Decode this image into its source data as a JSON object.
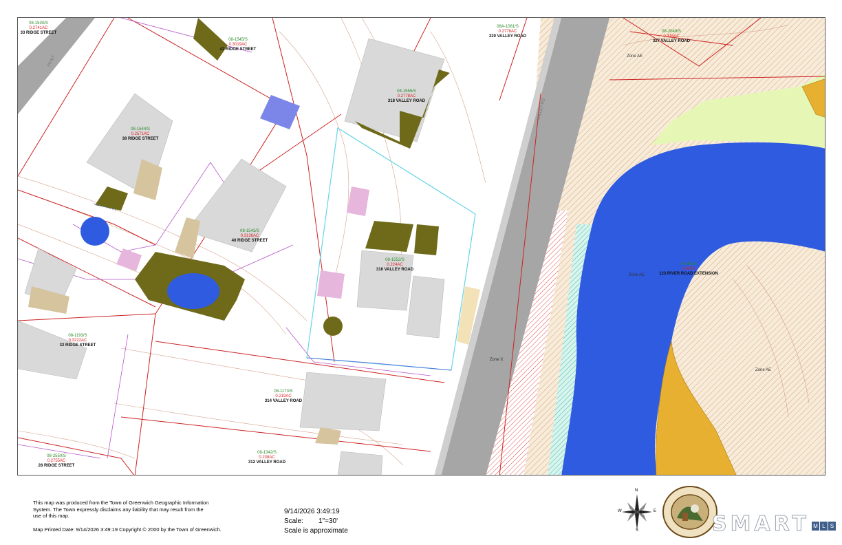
{
  "map": {
    "parcels": [
      {
        "id": "08-1530/S",
        "area": "0.2741AC",
        "address": "33 RIDGE STREET"
      },
      {
        "id": "08-1545/S",
        "area": "0.3019AC",
        "address": "42 RIDGE STREET"
      },
      {
        "id": "08-1555/S",
        "area": "0.2778AC",
        "address": "318 VALLEY ROAD"
      },
      {
        "id": "08A-1081/S",
        "area": "0.2778AC",
        "address": "320 VALLEY ROAD"
      },
      {
        "id": "08-2049/S",
        "area": "0.315AC",
        "address": "327 VALLEY ROAD"
      },
      {
        "id": "08-1544/S",
        "area": "0.2571AC",
        "address": "38 RIDGE STREET"
      },
      {
        "id": "08-1543/S",
        "area": "0.3136AC",
        "address": "40 RIDGE STREET"
      },
      {
        "id": "08-1552/S",
        "area": "0.224AC",
        "address": "316 VALLEY ROAD"
      },
      {
        "id": "08-4810",
        "area": "0.4240",
        "address": "123 RIVER ROAD EXTENSION"
      },
      {
        "id": "08-1193/S",
        "area": "0.3222AC",
        "address": "32 RIDGE STREET"
      },
      {
        "id": "08-1173/S",
        "area": "0.219AC",
        "address": "314 VALLEY ROAD"
      },
      {
        "id": "08-2550/S",
        "area": "0.2755AC",
        "address": "28 RIDGE STREET"
      },
      {
        "id": "08-1342/S",
        "area": "0.238AC",
        "address": "312 VALLEY ROAD"
      }
    ],
    "flood_zones": {
      "zone_ae_top": "Zone AE",
      "zone_ae_river": "Zone AE",
      "zone_ae_right": "Zone AE",
      "zone_x": "Zone X"
    },
    "road_labels": {
      "left_road": "PKWY",
      "valley_road": "VALLEY RD"
    },
    "colors": {
      "water": "#2f5be0",
      "structure": "#d9d9d9",
      "impervious": "#6e6a1a",
      "parcel_line": "#cc2222",
      "subject_lot": "#66d4e6",
      "wetland_green": "#e6f7b5",
      "zone_orange": "#e8b030",
      "hatch_tan": "#f2e2c8"
    }
  },
  "footer": {
    "disclaimer": "This map was produced from the Town of Greenwich Geographic Information System.  The Town expressly disclaims any liability that may result from the use of this map.",
    "printed": "Map Printed Date: 9/14/2026 3:49:19    Copyright © 2000 by the Town of Greenwich.",
    "timestamp": "9/14/2026 3:49:19",
    "scale_label": "Scale:",
    "scale_value": "1\"=30'",
    "scale_note": "Scale is approximate"
  },
  "compass": {
    "n": "N",
    "s": "S",
    "e": "E",
    "w": "W"
  },
  "seal": {
    "top_text": "TOWN OF GREENWICH CONN",
    "bottom_text": "SEAL"
  },
  "logo": {
    "smart": "SMART",
    "mls": [
      "M",
      "L",
      "S"
    ]
  }
}
